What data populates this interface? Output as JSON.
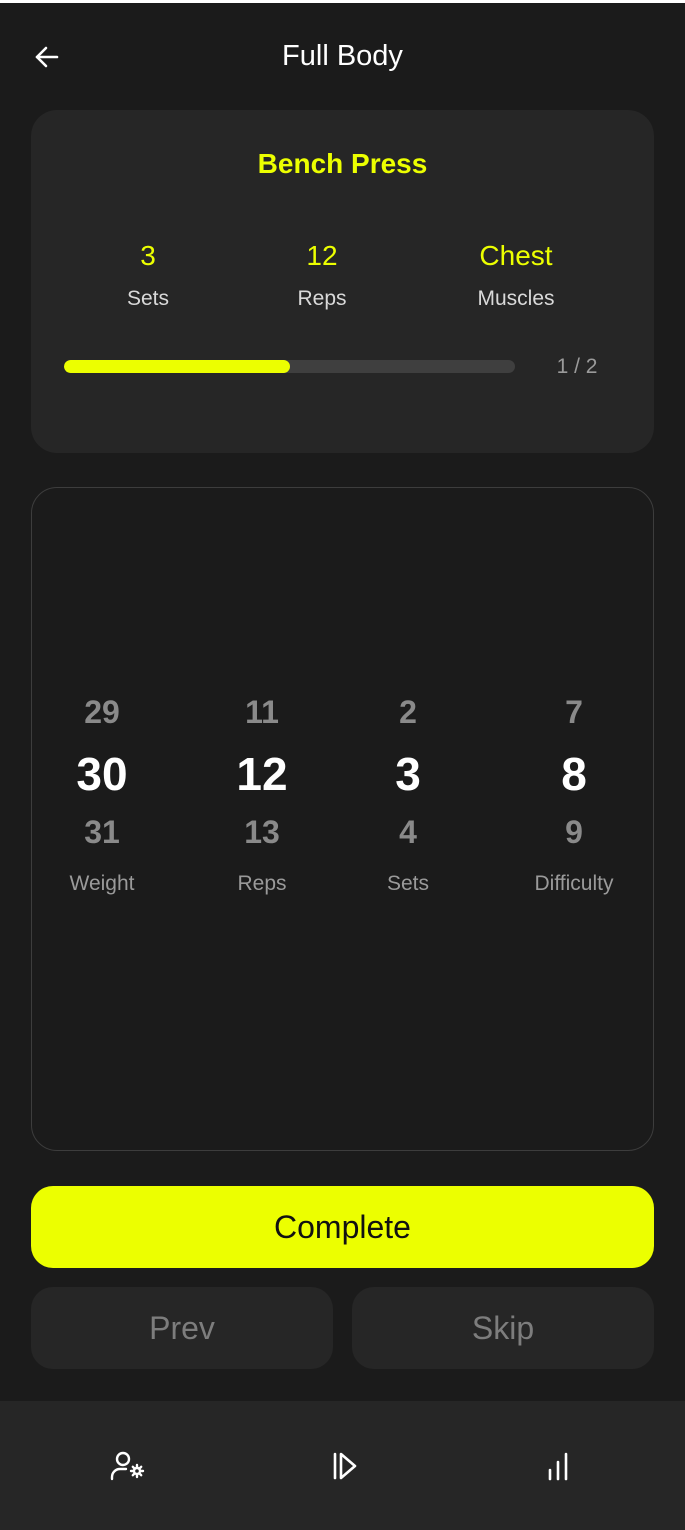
{
  "header": {
    "title": "Full Body",
    "back_icon": "arrow-left-icon"
  },
  "exercise": {
    "name": "Bench Press",
    "stats": [
      {
        "value": "3",
        "label": "Sets"
      },
      {
        "value": "12",
        "label": "Reps"
      },
      {
        "value": "Chest",
        "label": "Muscles"
      }
    ],
    "progress": {
      "fraction": 0.5,
      "text": "1 / 2"
    }
  },
  "picker": {
    "columns": [
      {
        "prev": "29",
        "current": "30",
        "next": "31",
        "label": "Weight"
      },
      {
        "prev": "11",
        "current": "12",
        "next": "13",
        "label": "Reps"
      },
      {
        "prev": "2",
        "current": "3",
        "next": "4",
        "label": "Sets"
      },
      {
        "prev": "7",
        "current": "8",
        "next": "9",
        "label": "Difficulty"
      }
    ]
  },
  "actions": {
    "complete_label": "Complete",
    "prev_label": "Prev",
    "skip_label": "Skip"
  },
  "nav": {
    "items": [
      {
        "icon": "user-settings-icon"
      },
      {
        "icon": "play-skip-icon"
      },
      {
        "icon": "bar-chart-icon"
      }
    ]
  },
  "colors": {
    "accent": "#ecff00",
    "background": "#1b1b1b",
    "card": "#262626"
  }
}
